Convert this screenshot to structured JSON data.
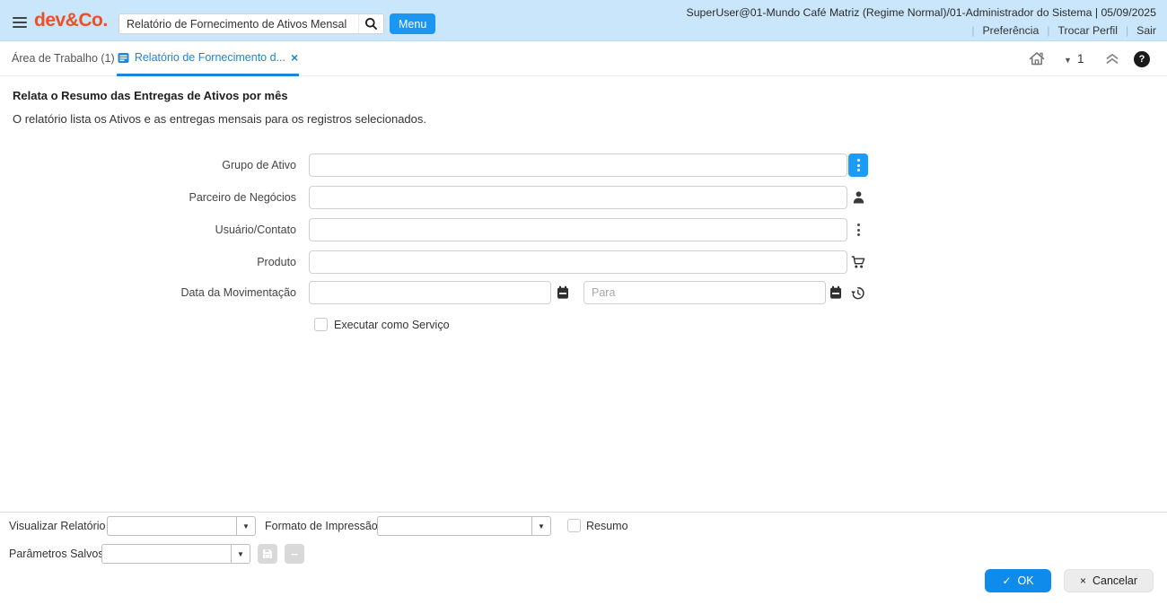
{
  "header": {
    "brand": "dev&Co.",
    "search": {
      "value": "Relatório de Fornecimento de Ativos Mensal"
    },
    "menu_button": "Menu",
    "user_info": "SuperUser@01-Mundo Café Matriz (Regime Normal)/01-Administrador do Sistema | 05/09/2025",
    "links": {
      "preferences": "Preferência",
      "switch_role": "Trocar Perfil",
      "logout": "Sair"
    }
  },
  "tabs": {
    "workspace_label": "Área de Trabalho (1)",
    "active_label": "Relatório de Fornecimento d...",
    "page_indicator": "1"
  },
  "process": {
    "title": "Relata o Resumo das Entregas de Ativos por mês",
    "description": "O relatório lista os Ativos e as entregas mensais para os registros selecionados."
  },
  "form": {
    "fields": [
      {
        "label": "Grupo de Ativo"
      },
      {
        "label": "Parceiro de Negócios"
      },
      {
        "label": "Usuário/Contato"
      },
      {
        "label": "Produto"
      },
      {
        "label": "Data da Movimentação",
        "to_placeholder": "Para"
      }
    ],
    "run_as_job_label": "Executar como Serviço"
  },
  "footer": {
    "view_report_label": "Visualizar Relatório",
    "print_format_label": "Formato de Impressão",
    "summary_label": "Resumo",
    "saved_parameters_label": "Parâmetros Salvos",
    "ok_label": "OK",
    "cancel_label": "Cancelar"
  },
  "icons": {
    "check": "✓",
    "close": "×",
    "caret_down": "▼",
    "minus": "−",
    "help": "?"
  },
  "colors": {
    "header_bg": "#c9e6fb",
    "brand": "#f04e23",
    "primary_blue": "#1b96f3",
    "tab_active_blue": "#1886e0",
    "lookup_button_blue": "#1b9df7",
    "ok_button_blue": "#0f8ceb"
  }
}
